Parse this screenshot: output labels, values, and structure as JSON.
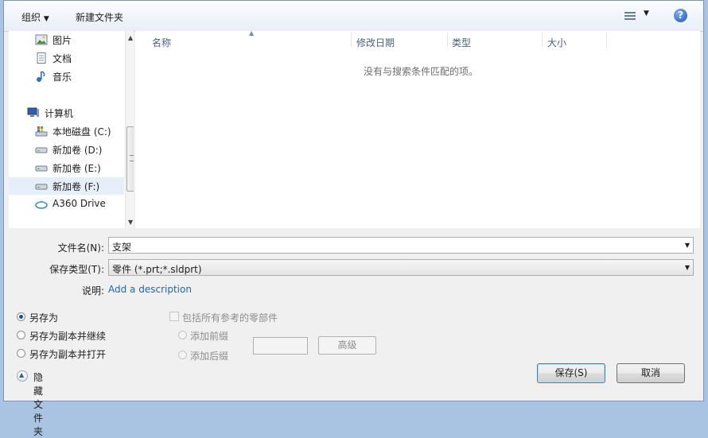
{
  "toolbar": {
    "organize_label": "组织",
    "new_folder_label": "新建文件夹",
    "help_label": "?"
  },
  "nav": {
    "items": [
      {
        "label": "图片",
        "icon": "pictures-icon"
      },
      {
        "label": "文档",
        "icon": "documents-icon"
      },
      {
        "label": "音乐",
        "icon": "music-icon"
      },
      {
        "label": "计算机",
        "icon": "computer-icon"
      },
      {
        "label": "本地磁盘 (C:)",
        "icon": "system-drive-icon"
      },
      {
        "label": "新加卷 (D:)",
        "icon": "drive-icon"
      },
      {
        "label": "新加卷 (E:)",
        "icon": "drive-icon"
      },
      {
        "label": "新加卷 (F:)",
        "icon": "drive-icon",
        "selected": true
      },
      {
        "label": "A360 Drive",
        "icon": "cloud-drive-icon"
      }
    ]
  },
  "list": {
    "columns": [
      "名称",
      "修改日期",
      "类型",
      "大小"
    ],
    "empty_message": "没有与搜索条件匹配的项。"
  },
  "form": {
    "filename_label": "文件名(N):",
    "filename_value": "支架",
    "savetype_label": "保存类型(T):",
    "savetype_value": "零件 (*.prt;*.sldprt)",
    "description_label": "说明:",
    "description_link": "Add a description"
  },
  "options": {
    "save_as": "另存为",
    "save_as_copy_continue": "另存为副本并继续",
    "save_as_copy_open": "另存为副本并打开",
    "include_refs": "包括所有参考的零部件",
    "add_prefix": "添加前缀",
    "add_suffix": "添加后缀",
    "advanced": "高级"
  },
  "footer": {
    "hide_folders": "隐藏文件夹",
    "save": "保存(S)",
    "cancel": "取消"
  },
  "colors": {
    "link": "#1f66b2",
    "selected_bg": "#e5eef9",
    "accent": "#3c7fb1"
  }
}
